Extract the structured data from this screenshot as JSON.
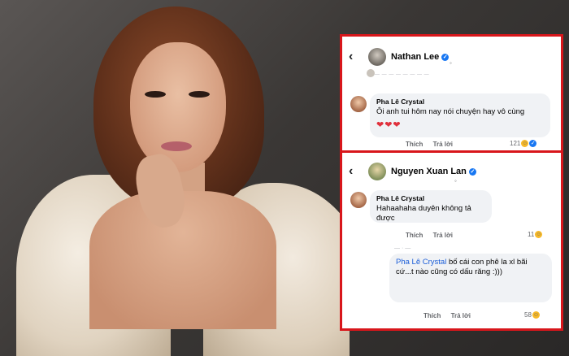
{
  "top_post": {
    "author": "Nathan Lee",
    "verified": true,
    "comment": {
      "name": "Pha Lê Crystal",
      "text": "Ôi anh tui hôm nay nói chuyện hay vô cùng",
      "hearts": "❤❤❤",
      "like_label": "Thích",
      "reply_label": "Trả lời",
      "reaction_count": "121"
    }
  },
  "bottom_post": {
    "author": "Nguyen Xuan Lan",
    "verified": true,
    "comment": {
      "name": "Pha Lê Crystal",
      "text": "Hahaahaha duyên không tả được",
      "like_label": "Thích",
      "reply_label": "Trả lời",
      "reaction_count": "11"
    },
    "reply": {
      "mention": "Pha Lê Crystal",
      "text": " bố cái con phê la xl bãi cứ...t nào cũng có dấu răng :)))",
      "like_label": "Thích",
      "reply_label": "Trả lời",
      "reaction_count": "58"
    }
  },
  "colors": {
    "frame": "#d8161b",
    "verified": "#1877f2",
    "bubble": "#f0f2f5"
  },
  "icons": {
    "back": "chevron-left-icon",
    "verified": "verified-badge-icon",
    "haha": "haha-reaction-icon",
    "like": "like-reaction-icon"
  }
}
